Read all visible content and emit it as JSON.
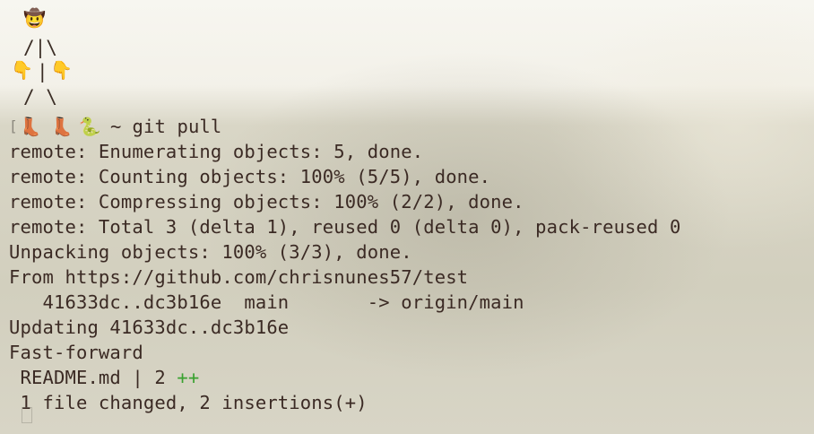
{
  "prompt": {
    "head_emoji": "🤠",
    "arm_line": "/|\\",
    "hand_left": "👇",
    "hand_right": "👇",
    "body_line": "|",
    "leg_line": "/ \\",
    "boot_left": "👢",
    "boot_right": "👢",
    "snake": "🐍",
    "bracket": "[",
    "symbol": "~",
    "command": "git pull"
  },
  "output": {
    "lines": [
      "remote: Enumerating objects: 5, done.",
      "remote: Counting objects: 100% (5/5), done.",
      "remote: Compressing objects: 100% (2/2), done.",
      "remote: Total 3 (delta 1), reused 0 (delta 0), pack-reused 0",
      "Unpacking objects: 100% (3/3), done.",
      "From https://github.com/chrisnunes57/test",
      "   41633dc..dc3b16e  main       -> origin/main",
      "Updating 41633dc..dc3b16e",
      "Fast-forward"
    ],
    "diffstat_file": " README.md | 2 ",
    "diffstat_plus": "++",
    "summary": " 1 file changed, 2 insertions(+)"
  }
}
